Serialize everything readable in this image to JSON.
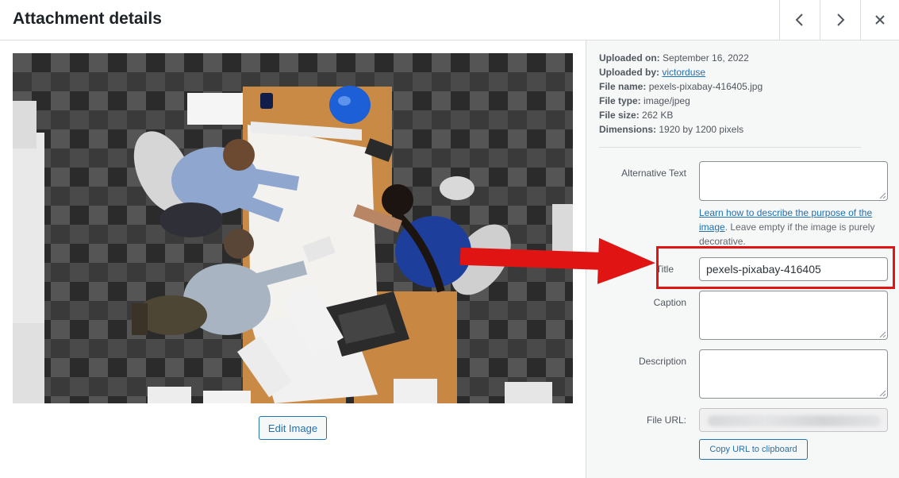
{
  "header": {
    "title": "Attachment details",
    "prev_icon": "chevron-left-icon",
    "next_icon": "chevron-right-icon",
    "close_icon": "close-icon"
  },
  "media": {
    "edit_image_label": "Edit Image"
  },
  "details": {
    "uploaded_on_label": "Uploaded on:",
    "uploaded_on_value": "September 16, 2022",
    "uploaded_by_label": "Uploaded by:",
    "uploaded_by_value": "victorduse",
    "file_name_label": "File name:",
    "file_name_value": "pexels-pixabay-416405.jpg",
    "file_type_label": "File type:",
    "file_type_value": "image/jpeg",
    "file_size_label": "File size:",
    "file_size_value": "262 KB",
    "dimensions_label": "Dimensions:",
    "dimensions_value": "1920 by 1200 pixels"
  },
  "fields": {
    "alt_text_label": "Alternative Text",
    "alt_text_value": "",
    "alt_help_link": "Learn how to describe the purpose of the image",
    "alt_help_text": ". Leave empty if the image is purely decorative.",
    "title_label": "Title",
    "title_value": "pexels-pixabay-416405",
    "caption_label": "Caption",
    "caption_value": "",
    "description_label": "Description",
    "description_value": "",
    "file_url_label": "File URL:",
    "copy_url_label": "Copy URL to clipboard"
  },
  "annotation": {
    "highlight_color": "#e11414"
  },
  "colors": {
    "link": "#2271b1",
    "sidebar_bg": "#f6f7f7"
  }
}
